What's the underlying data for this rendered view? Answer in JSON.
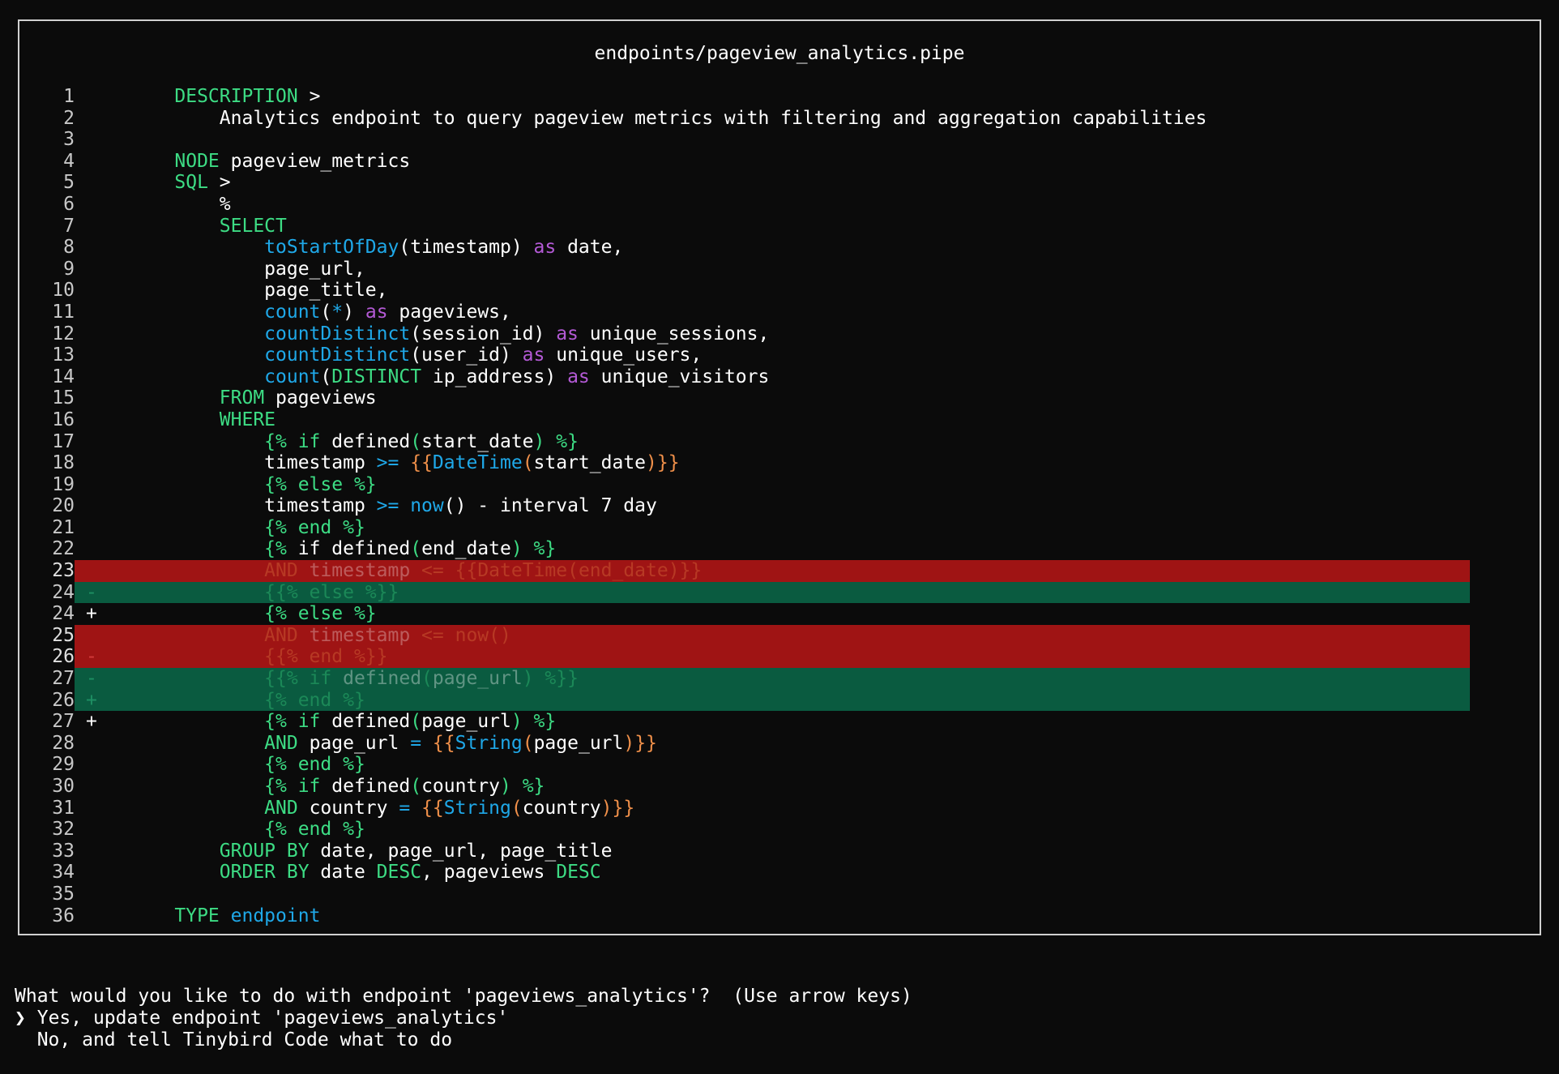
{
  "panel": {
    "title": "endpoints/pageview_analytics.pipe",
    "lines": [
      {
        "n": "1",
        "mark": "",
        "kind": "ctx",
        "tokens": [
          [
            "    ",
            "tx"
          ],
          [
            "DESCRIPTION",
            "kw"
          ],
          [
            " >",
            "tx"
          ]
        ]
      },
      {
        "n": "2",
        "mark": "",
        "kind": "ctx",
        "tokens": [
          [
            "        Analytics endpoint to query pageview metrics with filtering and aggregation capabilities",
            "tx"
          ]
        ]
      },
      {
        "n": "3",
        "mark": "",
        "kind": "ctx",
        "tokens": []
      },
      {
        "n": "4",
        "mark": "",
        "kind": "ctx",
        "tokens": [
          [
            "    ",
            "tx"
          ],
          [
            "NODE",
            "kw"
          ],
          [
            " pageview_metrics",
            "tx"
          ]
        ]
      },
      {
        "n": "5",
        "mark": "",
        "kind": "ctx",
        "tokens": [
          [
            "    ",
            "tx"
          ],
          [
            "SQL",
            "kw"
          ],
          [
            " >",
            "tx"
          ]
        ]
      },
      {
        "n": "6",
        "mark": "",
        "kind": "ctx",
        "tokens": [
          [
            "        %",
            "tx"
          ]
        ]
      },
      {
        "n": "7",
        "mark": "",
        "kind": "ctx",
        "tokens": [
          [
            "        ",
            "tx"
          ],
          [
            "SELECT",
            "kw"
          ]
        ]
      },
      {
        "n": "8",
        "mark": "",
        "kind": "ctx",
        "tokens": [
          [
            "            ",
            "tx"
          ],
          [
            "toStartOfDay",
            "fn"
          ],
          [
            "(timestamp) ",
            "tx"
          ],
          [
            "as",
            "as"
          ],
          [
            " date,",
            "tx"
          ]
        ]
      },
      {
        "n": "9",
        "mark": "",
        "kind": "ctx",
        "tokens": [
          [
            "            page_url,",
            "tx"
          ]
        ]
      },
      {
        "n": "10",
        "mark": "",
        "kind": "ctx",
        "tokens": [
          [
            "            page_title,",
            "tx"
          ]
        ]
      },
      {
        "n": "11",
        "mark": "",
        "kind": "ctx",
        "tokens": [
          [
            "            ",
            "tx"
          ],
          [
            "count",
            "fn"
          ],
          [
            "(",
            "tx"
          ],
          [
            "*",
            "fn"
          ],
          [
            ") ",
            "tx"
          ],
          [
            "as",
            "as"
          ],
          [
            " pageviews,",
            "tx"
          ]
        ]
      },
      {
        "n": "12",
        "mark": "",
        "kind": "ctx",
        "tokens": [
          [
            "            ",
            "tx"
          ],
          [
            "countDistinct",
            "fn"
          ],
          [
            "(session_id) ",
            "tx"
          ],
          [
            "as",
            "as"
          ],
          [
            " unique_sessions,",
            "tx"
          ]
        ]
      },
      {
        "n": "13",
        "mark": "",
        "kind": "ctx",
        "tokens": [
          [
            "            ",
            "tx"
          ],
          [
            "countDistinct",
            "fn"
          ],
          [
            "(user_id) ",
            "tx"
          ],
          [
            "as",
            "as"
          ],
          [
            " unique_users,",
            "tx"
          ]
        ]
      },
      {
        "n": "14",
        "mark": "",
        "kind": "ctx",
        "tokens": [
          [
            "            ",
            "tx"
          ],
          [
            "count",
            "fn"
          ],
          [
            "(",
            "tx"
          ],
          [
            "DISTINCT",
            "kw"
          ],
          [
            " ip_address) ",
            "tx"
          ],
          [
            "as",
            "as"
          ],
          [
            " unique_visitors",
            "tx"
          ]
        ]
      },
      {
        "n": "15",
        "mark": "",
        "kind": "ctx",
        "tokens": [
          [
            "        ",
            "tx"
          ],
          [
            "FROM",
            "kw"
          ],
          [
            " pageviews",
            "tx"
          ]
        ]
      },
      {
        "n": "16",
        "mark": "",
        "kind": "ctx",
        "tokens": [
          [
            "        ",
            "tx"
          ],
          [
            "WHERE",
            "kw"
          ]
        ]
      },
      {
        "n": "17",
        "mark": "",
        "kind": "ctx",
        "tokens": [
          [
            "            ",
            "tx"
          ],
          [
            "{% if",
            "kw"
          ],
          [
            " defined",
            "tx"
          ],
          [
            "(",
            "kw"
          ],
          [
            "start_date",
            "tx"
          ],
          [
            ") %}",
            "kw"
          ]
        ]
      },
      {
        "n": "18",
        "mark": "",
        "kind": "ctx",
        "tokens": [
          [
            "            timestamp ",
            "tx"
          ],
          [
            ">=",
            "fn"
          ],
          [
            " ",
            "tx"
          ],
          [
            "{{",
            "op"
          ],
          [
            "DateTime",
            "fn"
          ],
          [
            "(",
            "op"
          ],
          [
            "start_date",
            "tx"
          ],
          [
            ")}}",
            "op"
          ]
        ]
      },
      {
        "n": "19",
        "mark": "",
        "kind": "ctx",
        "tokens": [
          [
            "            ",
            "tx"
          ],
          [
            "{% else %}",
            "kw"
          ]
        ]
      },
      {
        "n": "20",
        "mark": "",
        "kind": "ctx",
        "tokens": [
          [
            "            timestamp ",
            "tx"
          ],
          [
            ">=",
            "fn"
          ],
          [
            " ",
            "tx"
          ],
          [
            "now",
            "fn"
          ],
          [
            "() - interval 7 day",
            "tx"
          ]
        ]
      },
      {
        "n": "21",
        "mark": "",
        "kind": "ctx",
        "tokens": [
          [
            "            ",
            "tx"
          ],
          [
            "{% end %}",
            "kw"
          ]
        ]
      },
      {
        "n": "22",
        "mark": "",
        "kind": "ctx",
        "tokens": [
          [
            "            ",
            "tx"
          ],
          [
            "{%",
            "kw"
          ],
          [
            " if defined",
            "tx"
          ],
          [
            "(",
            "kw"
          ],
          [
            "end_date",
            "tx"
          ],
          [
            ") %}",
            "kw"
          ]
        ]
      },
      {
        "n": "23",
        "mark": "",
        "kind": "del",
        "tokens": [
          [
            "            ",
            "tx"
          ],
          [
            "AND",
            "op"
          ],
          [
            " timestamp ",
            "tx"
          ],
          [
            "<=",
            "op"
          ],
          [
            " ",
            "tx"
          ],
          [
            "{{",
            "op"
          ],
          [
            "DateTime",
            "op"
          ],
          [
            "(end_date)}}",
            "op"
          ]
        ]
      },
      {
        "n": "24",
        "mark": "-",
        "kind": "add",
        "tokens": [
          [
            "            ",
            "tx"
          ],
          [
            "{{% else %}}",
            "kw"
          ]
        ]
      },
      {
        "n": "24",
        "mark": "+",
        "kind": "ctx",
        "tokens": [
          [
            "            ",
            "tx"
          ],
          [
            "{% else %}",
            "kw"
          ]
        ]
      },
      {
        "n": "25",
        "mark": "",
        "kind": "del",
        "tokens": [
          [
            "            ",
            "tx"
          ],
          [
            "AND",
            "op"
          ],
          [
            " timestamp ",
            "tx"
          ],
          [
            "<=",
            "op"
          ],
          [
            " now()",
            "op"
          ]
        ]
      },
      {
        "n": "26",
        "mark": "-",
        "kind": "del",
        "tokens": [
          [
            "            ",
            "tx"
          ],
          [
            "{{% end %}}",
            "op"
          ]
        ]
      },
      {
        "n": "27",
        "mark": "-",
        "kind": "add",
        "tokens": [
          [
            "            ",
            "tx"
          ],
          [
            "{{% if",
            "kw"
          ],
          [
            " defined",
            "tx"
          ],
          [
            "(",
            "kw"
          ],
          [
            "page_url",
            "tx"
          ],
          [
            ") %}}",
            "kw"
          ]
        ]
      },
      {
        "n": "26",
        "mark": "+",
        "kind": "add",
        "tokens": [
          [
            "            ",
            "tx"
          ],
          [
            "{% end %}",
            "kw"
          ]
        ]
      },
      {
        "n": "27",
        "mark": "+",
        "kind": "ctx",
        "tokens": [
          [
            "            ",
            "tx"
          ],
          [
            "{% if",
            "kw"
          ],
          [
            " defined",
            "tx"
          ],
          [
            "(",
            "kw"
          ],
          [
            "page_url",
            "tx"
          ],
          [
            ") %}",
            "kw"
          ]
        ]
      },
      {
        "n": "28",
        "mark": "",
        "kind": "ctx",
        "tokens": [
          [
            "            ",
            "tx"
          ],
          [
            "AND",
            "kw"
          ],
          [
            " page_url ",
            "tx"
          ],
          [
            "=",
            "fn"
          ],
          [
            " ",
            "tx"
          ],
          [
            "{{",
            "op"
          ],
          [
            "String",
            "fn"
          ],
          [
            "(",
            "op"
          ],
          [
            "page_url",
            "tx"
          ],
          [
            ")}}",
            "op"
          ]
        ]
      },
      {
        "n": "29",
        "mark": "",
        "kind": "ctx",
        "tokens": [
          [
            "            ",
            "tx"
          ],
          [
            "{% end %}",
            "kw"
          ]
        ]
      },
      {
        "n": "30",
        "mark": "",
        "kind": "ctx",
        "tokens": [
          [
            "            ",
            "tx"
          ],
          [
            "{% if",
            "kw"
          ],
          [
            " defined",
            "tx"
          ],
          [
            "(",
            "kw"
          ],
          [
            "country",
            "tx"
          ],
          [
            ") %}",
            "kw"
          ]
        ]
      },
      {
        "n": "31",
        "mark": "",
        "kind": "ctx",
        "tokens": [
          [
            "            ",
            "tx"
          ],
          [
            "AND",
            "kw"
          ],
          [
            " country ",
            "tx"
          ],
          [
            "=",
            "fn"
          ],
          [
            " ",
            "tx"
          ],
          [
            "{{",
            "op"
          ],
          [
            "String",
            "fn"
          ],
          [
            "(",
            "op"
          ],
          [
            "country",
            "tx"
          ],
          [
            ")}}",
            "op"
          ]
        ]
      },
      {
        "n": "32",
        "mark": "",
        "kind": "ctx",
        "tokens": [
          [
            "            ",
            "tx"
          ],
          [
            "{% end %}",
            "kw"
          ]
        ]
      },
      {
        "n": "33",
        "mark": "",
        "kind": "ctx",
        "tokens": [
          [
            "        ",
            "tx"
          ],
          [
            "GROUP BY",
            "kw"
          ],
          [
            " date, page_url, page_title",
            "tx"
          ]
        ]
      },
      {
        "n": "34",
        "mark": "",
        "kind": "ctx",
        "tokens": [
          [
            "        ",
            "tx"
          ],
          [
            "ORDER BY",
            "kw"
          ],
          [
            " date ",
            "tx"
          ],
          [
            "DESC",
            "kw"
          ],
          [
            ", pageviews ",
            "tx"
          ],
          [
            "DESC",
            "kw"
          ]
        ]
      },
      {
        "n": "35",
        "mark": "",
        "kind": "ctx",
        "tokens": []
      },
      {
        "n": "36",
        "mark": "",
        "kind": "ctx",
        "tokens": [
          [
            "    ",
            "tx"
          ],
          [
            "TYPE",
            "kw"
          ],
          [
            " ",
            "tx"
          ],
          [
            "endpoint",
            "fn"
          ]
        ]
      }
    ]
  },
  "prompt": {
    "question": "What would you like to do with endpoint 'pageviews_analytics'?  (Use arrow keys)",
    "pointer": "❯",
    "options": [
      "Yes, update endpoint 'pageviews_analytics'",
      "No, and tell Tinybird Code what to do"
    ]
  }
}
